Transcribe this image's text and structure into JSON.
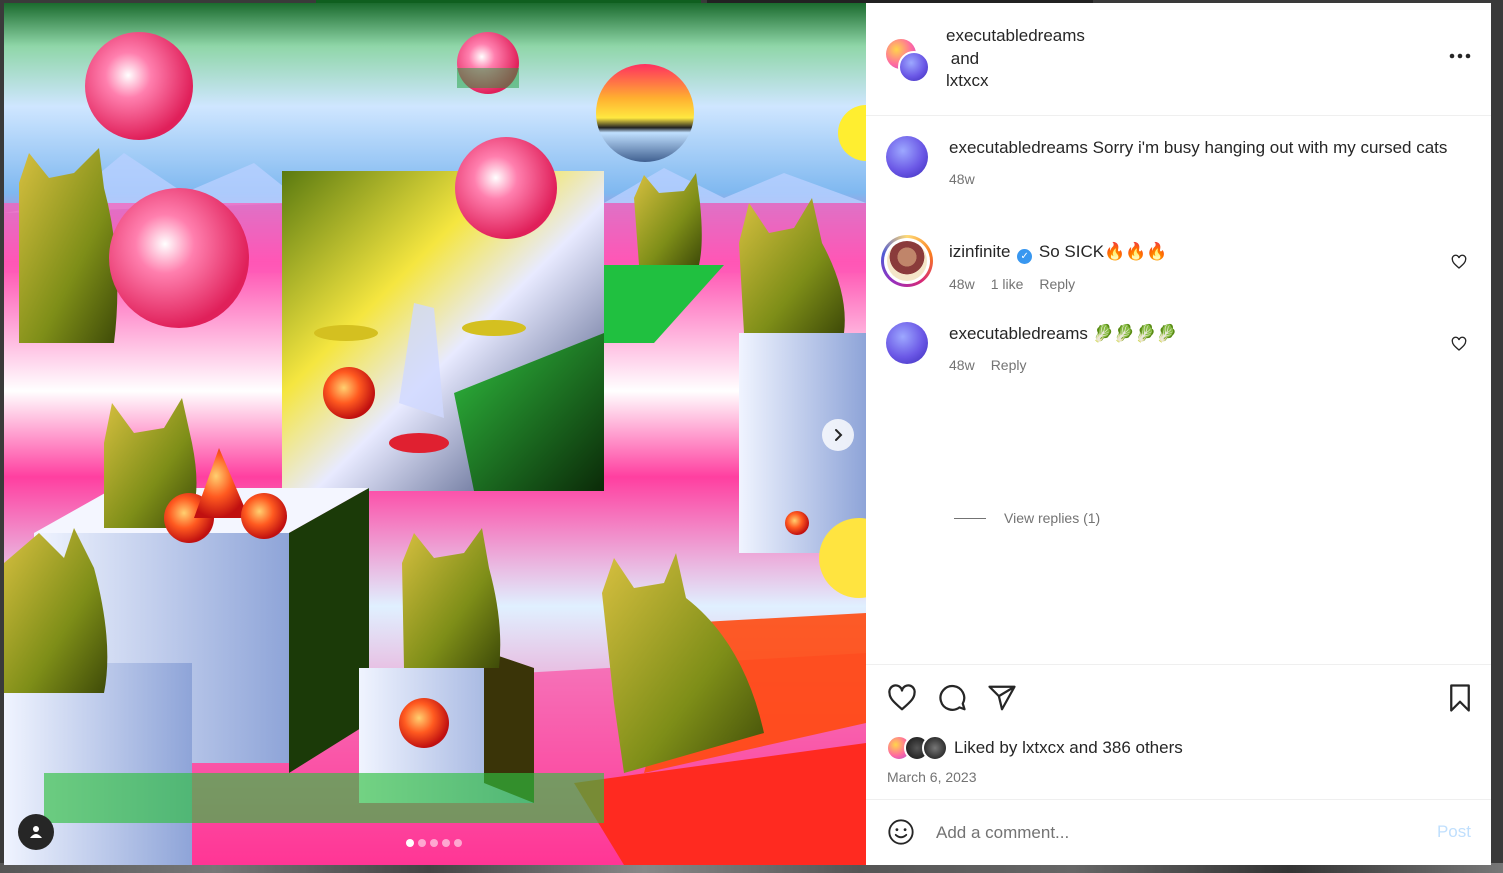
{
  "post": {
    "authors": [
      "executabledreams",
      "lxtxcx"
    ],
    "collab_joiner": "and",
    "more_icon": "ellipsis-icon"
  },
  "media": {
    "slide_count": 5,
    "active_slide": 1,
    "next_icon": "chevron-right-icon",
    "tag_icon": "user-icon"
  },
  "comments": [
    {
      "user": "executabledreams",
      "text": "Sorry i'm busy hanging out with my cursed cats",
      "time": "48w",
      "caption": true
    },
    {
      "user": "izinfinite",
      "verified": true,
      "text": "So SICK🔥🔥🔥",
      "time": "48w",
      "likes": "1 like",
      "reply_label": "Reply"
    },
    {
      "user": "executabledreams",
      "text": "🥬🥬🥬🥬",
      "time": "48w",
      "reply_label": "Reply"
    }
  ],
  "view_replies": "View replies (1)",
  "actions": {
    "like_icon": "heart-icon",
    "comment_icon": "comment-icon",
    "share_icon": "send-icon",
    "save_icon": "bookmark-icon"
  },
  "liked_by": {
    "prefix": "Liked by",
    "user": "lxtxcx",
    "joiner": "and",
    "others": "386 others"
  },
  "date": "March 6, 2023",
  "composer": {
    "placeholder": "Add a comment...",
    "post_label": "Post",
    "emoji_icon": "smiley-icon"
  },
  "colors": {
    "text": "#262626",
    "secondary": "#737373",
    "verified": "#3897f0",
    "post_disabled": "#c0dffd"
  }
}
